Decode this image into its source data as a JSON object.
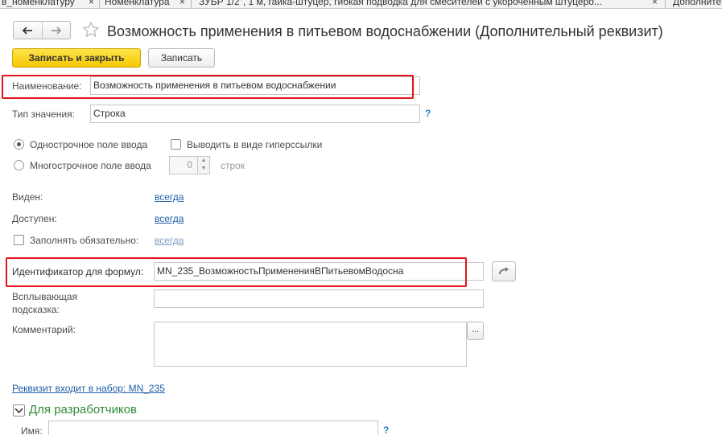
{
  "tabs": [
    {
      "label": "в_номенклатуру",
      "close": "×"
    },
    {
      "label": "Номенклатура",
      "close": "×"
    },
    {
      "label": "ЗУБР 1/2\", 1 м, гайка-штуцер, гибкая подводка для смесителей с укороченным штуцеро...",
      "close": "×"
    },
    {
      "label": "Дополните"
    }
  ],
  "header": {
    "title": "Возможность применения в питьевом водоснабжении (Дополнительный реквизит)"
  },
  "toolbar": {
    "save_close_label": "Записать и закрыть",
    "save_label": "Записать"
  },
  "form": {
    "name_label": "Наименование:",
    "name_value": "Возможность применения в питьевом водоснабжении",
    "type_label": "Тип значения:",
    "type_value": "Строка",
    "help_mark": "?",
    "single_line_label": "Однострочное поле ввода",
    "multi_line_label": "Многострочное поле ввода",
    "hyperlink_label": "Выводить в виде гиперссылки",
    "lines_count": "0",
    "lines_unit": "строк",
    "visible_label": "Виден:",
    "visible_value": "всегда",
    "available_label": "Доступен:",
    "available_value": "всегда",
    "required_label": "Заполнять обязательно:",
    "required_value": "всегда",
    "formula_id_label": "Идентификатор для формул:",
    "formula_id_value": "MN_235_ВозможностьПримененияВПитьевомВодосна",
    "tooltip_label_line1": "Всплывающая",
    "tooltip_label_line2": "подсказка:",
    "comment_label": "Комментарий:",
    "comment_button": "...",
    "set_link": "Реквизит входит в набор: MN_235",
    "developers_section": "Для разработчиков",
    "name_dev_label": "Имя:"
  },
  "colors": {
    "accent_yellow": "#f5c800",
    "highlight_red": "#e3141c",
    "link_blue": "#1f5fa8",
    "section_green": "#2f8a3a"
  }
}
